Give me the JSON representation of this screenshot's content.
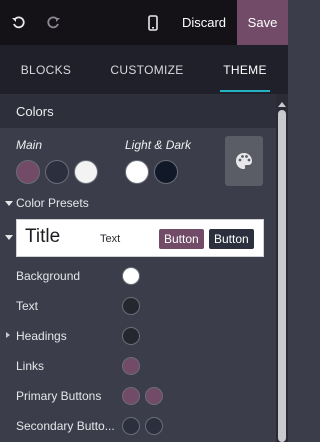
{
  "toolbar": {
    "undo_icon": "undo-icon",
    "redo_icon": "redo-icon",
    "mobile_icon": "mobile-preview-icon",
    "discard_label": "Discard",
    "save_label": "Save"
  },
  "tabs": [
    {
      "label": "BLOCKS",
      "active": false
    },
    {
      "label": "CUSTOMIZE",
      "active": false
    },
    {
      "label": "THEME",
      "active": true
    }
  ],
  "colors_section": {
    "title": "Colors",
    "main_label": "Main",
    "light_dark_label": "Light & Dark",
    "main_swatches": [
      "#714b67",
      "#2c2f3e",
      "#f2f3f2"
    ],
    "light_dark_swatches": [
      "#ffffff",
      "#111827"
    ],
    "palette_icon": "palette-icon"
  },
  "presets": {
    "title": "Color Presets",
    "preview": {
      "title": "Title",
      "text": "Text",
      "primary_button": "Button",
      "secondary_button": "Button"
    }
  },
  "color_rows": [
    {
      "label": "Background",
      "colors": [
        "#ffffff"
      ]
    },
    {
      "label": "Text",
      "colors": [
        "#25262e"
      ]
    },
    {
      "label": "Headings",
      "colors": [
        "#25262e"
      ],
      "expandable": true
    },
    {
      "label": "Links",
      "colors": [
        "#714b67"
      ]
    },
    {
      "label": "Primary Buttons",
      "colors": [
        "#714b67",
        "#714b67"
      ]
    },
    {
      "label": "Secondary Butto...",
      "colors": [
        "#2c2f3e",
        "#2c2f3e"
      ]
    }
  ],
  "accent_color": "#714b67",
  "tab_indicator_color": "#23b3c2"
}
